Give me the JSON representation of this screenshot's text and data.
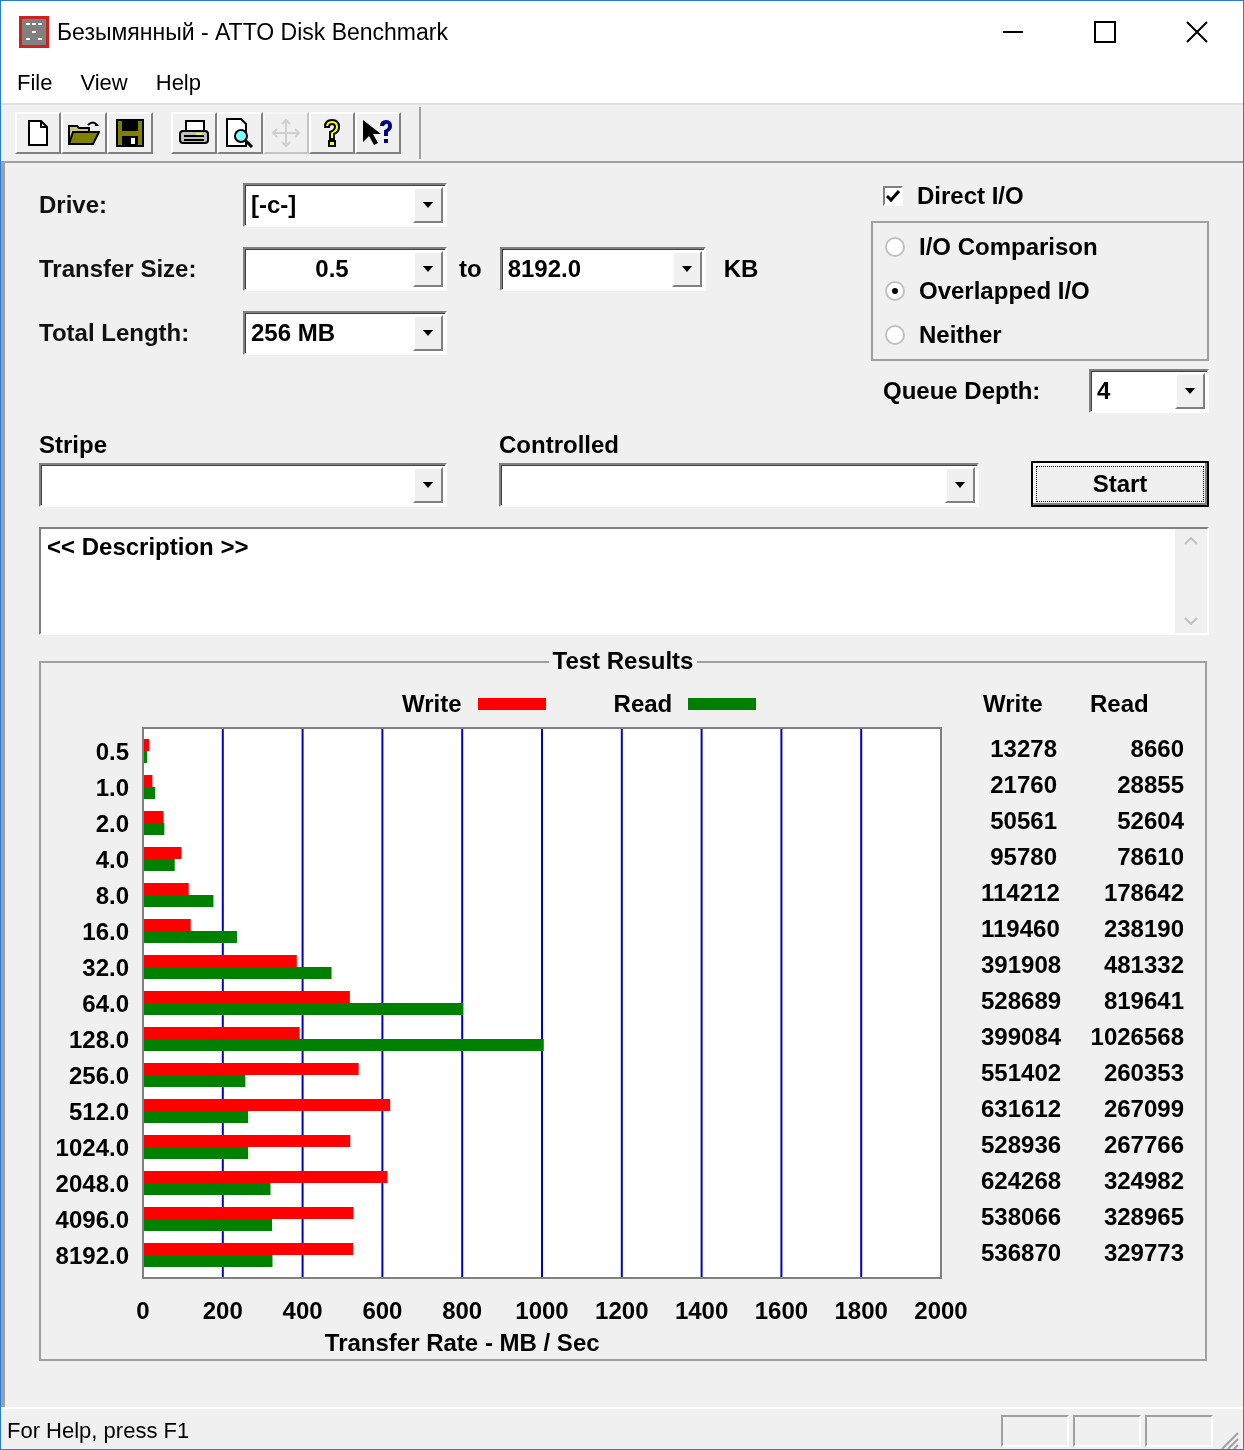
{
  "window": {
    "title": "Безымянный - ATTO Disk Benchmark"
  },
  "menu": [
    "File",
    "View",
    "Help"
  ],
  "toolbar": [
    {
      "kind": "new",
      "disabled": false
    },
    {
      "kind": "open",
      "disabled": false
    },
    {
      "kind": "save",
      "disabled": false
    },
    {
      "kind": "print",
      "disabled": false
    },
    {
      "kind": "preview",
      "disabled": false
    },
    {
      "kind": "move",
      "disabled": true
    },
    {
      "kind": "help",
      "disabled": false
    },
    {
      "kind": "context_help",
      "disabled": false
    }
  ],
  "form": {
    "drive": {
      "label": "Drive:",
      "value": "[-c-]"
    },
    "transfer_size": {
      "label": "Transfer Size:",
      "from": "0.5",
      "to_label": "to",
      "to": "8192.0",
      "unit": "KB"
    },
    "total_length": {
      "label": "Total Length:",
      "value": "256 MB"
    },
    "direct_io": {
      "label": "Direct I/O",
      "checked": true
    },
    "io_mode": [
      {
        "label": "I/O Comparison",
        "selected": false
      },
      {
        "label": "Overlapped I/O",
        "selected": true
      },
      {
        "label": "Neither",
        "selected": false
      }
    ],
    "queue_depth": {
      "label": "Queue Depth:",
      "value": "4"
    },
    "stripe": {
      "label": "Stripe"
    },
    "controlled": {
      "label": "Controlled"
    },
    "start_button": "Start",
    "description": "<< Description >>"
  },
  "results": {
    "columns": [
      "Write",
      "Read"
    ],
    "rows": [
      [
        "13278",
        "8660"
      ],
      [
        "21760",
        "28855"
      ],
      [
        "50561",
        "52604"
      ],
      [
        "95780",
        "78610"
      ],
      [
        "114212",
        "178642"
      ],
      [
        "119460",
        "238190"
      ],
      [
        "391908",
        "481332"
      ],
      [
        "528689",
        "819641"
      ],
      [
        "399084",
        "1026568"
      ],
      [
        "551402",
        "260353"
      ],
      [
        "631612",
        "267099"
      ],
      [
        "528936",
        "267766"
      ],
      [
        "624268",
        "324982"
      ],
      [
        "538066",
        "328965"
      ],
      [
        "536870",
        "329773"
      ]
    ],
    "chart_data": {
      "type": "bar",
      "orientation": "horizontal",
      "title": "Test Results",
      "xlabel": "Transfer Rate - MB / Sec",
      "categories": [
        "0.5",
        "1.0",
        "2.0",
        "4.0",
        "8.0",
        "16.0",
        "32.0",
        "64.0",
        "128.0",
        "256.0",
        "512.0",
        "1024.0",
        "2048.0",
        "4096.0",
        "8192.0"
      ],
      "series": [
        {
          "name": "Write",
          "color": "#ff0000",
          "values": [
            13,
            21,
            49,
            94,
            112,
            117,
            383,
            516,
            390,
            538,
            617,
            517,
            610,
            525,
            524
          ]
        },
        {
          "name": "Read",
          "color": "#008000",
          "values": [
            8,
            28,
            51,
            77,
            174,
            233,
            470,
            800,
            1002,
            254,
            261,
            261,
            317,
            321,
            322
          ]
        }
      ],
      "grid": true,
      "xlim": [
        0,
        2000
      ],
      "xticks": [
        0,
        200,
        400,
        600,
        800,
        1000,
        1200,
        1400,
        1600,
        1800,
        2000
      ]
    }
  },
  "status_bar": {
    "text": "For Help, press F1"
  }
}
